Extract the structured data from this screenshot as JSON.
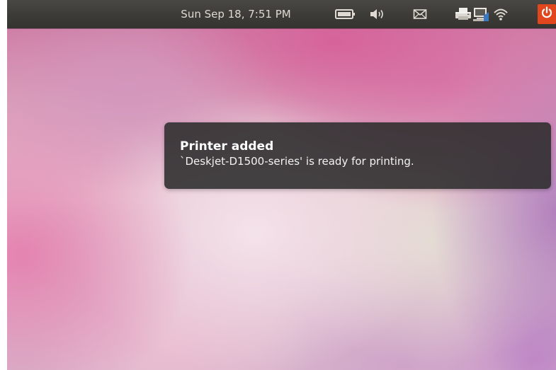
{
  "panel": {
    "clock": "Sun Sep 18,  7:51 PM",
    "indicators": [
      "battery-icon",
      "volume-icon",
      "mail-icon",
      "printer-icon",
      "network-icon",
      "wifi-icon",
      "power-icon"
    ],
    "session_button_color": "#e2461d"
  },
  "notification": {
    "title": "Printer added",
    "body": "`Deskjet-D1500-series' is ready for printing."
  }
}
